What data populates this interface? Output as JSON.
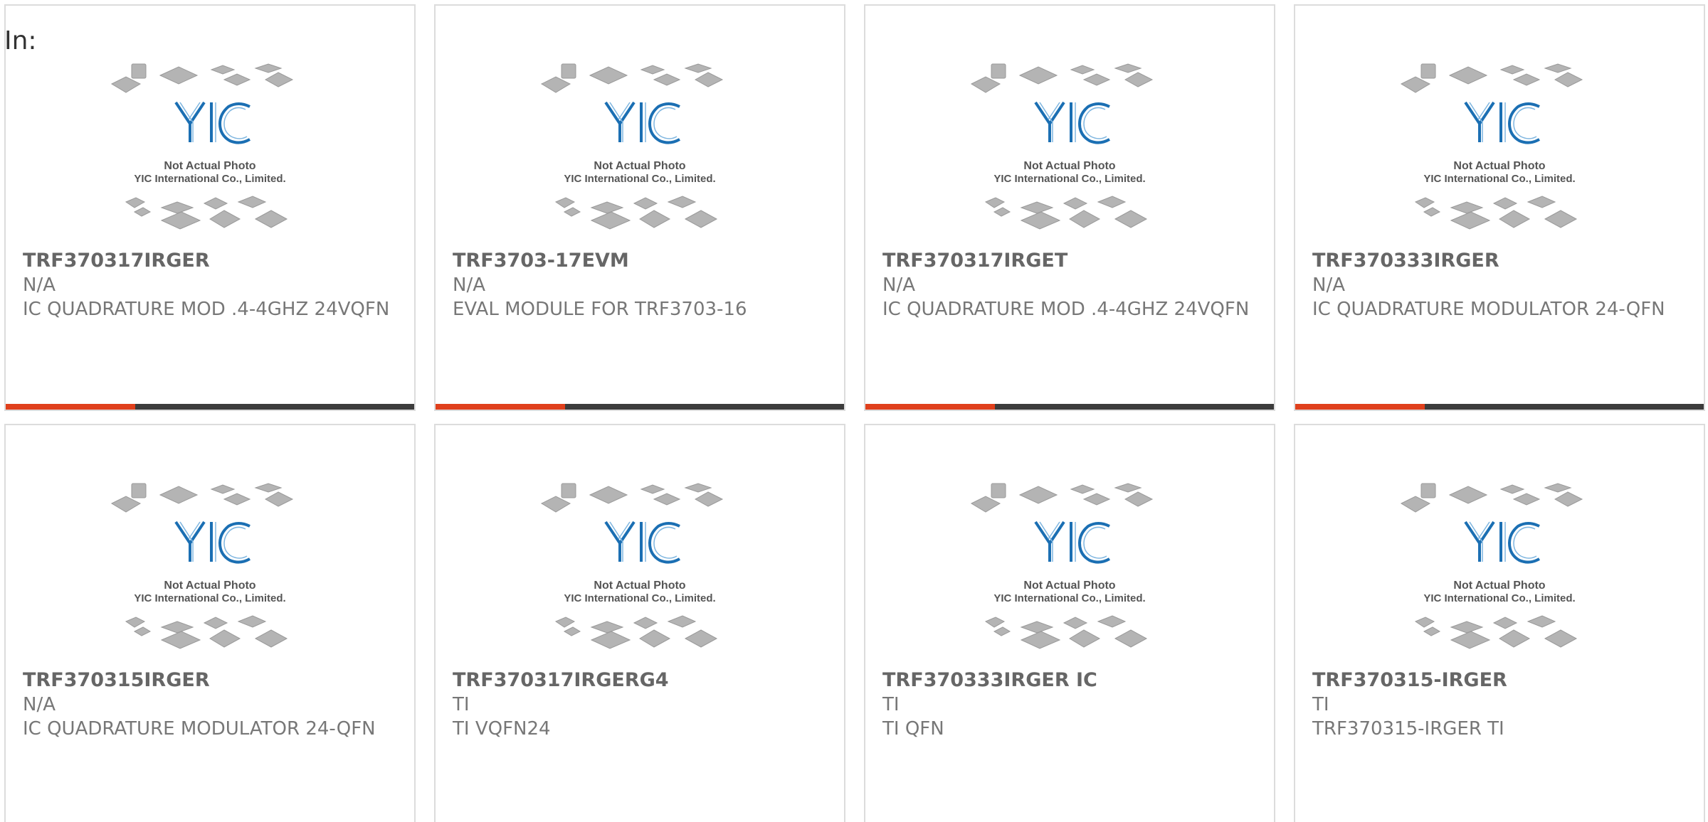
{
  "header": {
    "label": "In:"
  },
  "products": [
    {
      "part": "TRF370317IRGER",
      "manufacturer": "N/A",
      "description": "IC QUADRATURE MOD .4-4GHZ 24VQFN"
    },
    {
      "part": "TRF3703-17EVM",
      "manufacturer": "N/A",
      "description": "EVAL MODULE FOR TRF3703-16"
    },
    {
      "part": "TRF370317IRGET",
      "manufacturer": "N/A",
      "description": "IC QUADRATURE MOD .4-4GHZ 24VQFN"
    },
    {
      "part": "TRF370333IRGER",
      "manufacturer": "N/A",
      "description": "IC QUADRATURE MODULATOR 24-QFN"
    },
    {
      "part": "TRF370315IRGER",
      "manufacturer": "N/A",
      "description": "IC QUADRATURE MODULATOR 24-QFN"
    },
    {
      "part": "TRF370317IRGERG4",
      "manufacturer": "TI",
      "description": "TI VQFN24"
    },
    {
      "part": "TRF370333IRGER IC",
      "manufacturer": "TI",
      "description": "TI QFN"
    },
    {
      "part": "TRF370315-IRGER",
      "manufacturer": "TI",
      "description": "TRF370315-IRGER TI"
    }
  ],
  "placeholder": {
    "line1": "Not Actual Photo",
    "line2": "YIC International Co., Limited.",
    "logo": "YIC"
  },
  "colors": {
    "accent": "#e0401c",
    "bar": "#3c3c3c",
    "logo": "#1b6fb3"
  }
}
